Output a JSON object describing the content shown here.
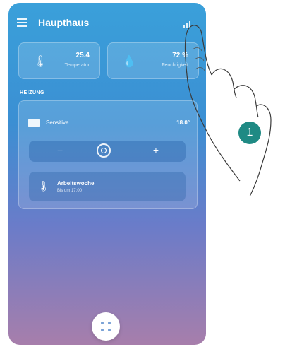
{
  "header": {
    "title": "Haupthaus",
    "menu_icon": "menu-icon",
    "stats_icon": "statistics-icon"
  },
  "metrics": {
    "temperature": {
      "value": "25.4",
      "label": "Temperatur",
      "icon": "thermometer-icon"
    },
    "humidity": {
      "value": "72 %",
      "label": "Feuchtigkeit",
      "icon": "humidity-icon"
    }
  },
  "heating": {
    "section_label": "HEIZUNG",
    "zone": {
      "name": "Sensitive",
      "temperature": "18.0°"
    },
    "controls": {
      "minus": "−",
      "plus": "+"
    },
    "schedule": {
      "title": "Arbeitswoche",
      "subtitle": "Bis um 17:00"
    }
  },
  "callout": {
    "step": "1"
  },
  "colors": {
    "gradient_top": "#3aa0da",
    "gradient_bottom": "#a77eab",
    "badge": "#1f8a84"
  }
}
